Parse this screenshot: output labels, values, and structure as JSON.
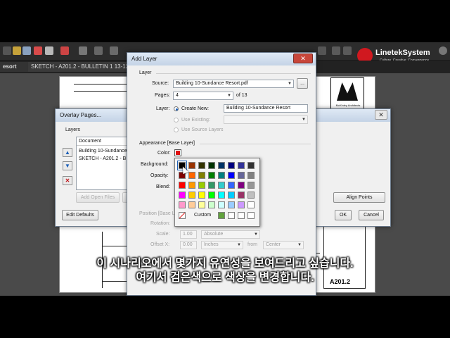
{
  "app": {
    "tabs": [
      {
        "label": "esort"
      },
      {
        "label": "SKETCH - A201.2 - BULLETIN 1 13-12-"
      }
    ],
    "sheet_number": "A201.2",
    "logo_caption": "McKinley Architects"
  },
  "brand": {
    "name": "LinetekSystem",
    "tagline": "Culture, Creative, Convergence"
  },
  "overlay_pages": {
    "title": "Overlay Pages...",
    "layers_label": "Layers",
    "column_header": "Document",
    "rows": [
      "Building 10-Sundance R",
      "SKETCH - A201.2 - B"
    ],
    "add_open_files": "Add Open Files",
    "align_points": "Align Points",
    "edit_defaults": "Edit Defaults",
    "ok": "OK",
    "cancel": "Cancel"
  },
  "add_layer": {
    "title": "Add Layer",
    "layer_section": "Layer",
    "source_label": "Source:",
    "source_value": "Building 10-Sundance Resort.pdf",
    "browse_label": "...",
    "pages_label": "Pages:",
    "pages_value": "4",
    "pages_of": "of 13",
    "layer_label": "Layer:",
    "create_new_label": "Create New:",
    "create_new_value": "Building 10-Sundance Resort",
    "use_existing_label": "Use Existing:",
    "use_source_layers_label": "Use Source Layers",
    "appearance_section": "Appearance [Base Layer]",
    "color_label": "Color:",
    "background_label": "Background:",
    "opacity_label": "Opacity:",
    "blend_label": "Blend:",
    "position_section": "Position [Base La",
    "rotation_label": "Rotation:",
    "scale_label": "Scale:",
    "scale_value": "1.00",
    "scale_mode": "Absolute",
    "offset_label": "Offset X:",
    "offset_value": "0.00",
    "offset_unit": "Inches",
    "from_label": "from",
    "from_value": "Center"
  },
  "color_picker": {
    "custom_label": "Custom",
    "selected_color": "#000000",
    "rows": [
      [
        "#000000",
        "#993300",
        "#333300",
        "#003300",
        "#003366",
        "#000080",
        "#333399",
        "#333333"
      ],
      [
        "#800000",
        "#FF6600",
        "#808000",
        "#008000",
        "#008080",
        "#0000FF",
        "#666699",
        "#808080"
      ],
      [
        "#FF0000",
        "#FF9900",
        "#99CC00",
        "#339966",
        "#33CCCC",
        "#3366FF",
        "#800080",
        "#969696"
      ],
      [
        "#FF00FF",
        "#FFCC00",
        "#FFFF00",
        "#00FF00",
        "#00FFFF",
        "#00CCFF",
        "#993366",
        "#C0C0C0"
      ],
      [
        "#FF99CC",
        "#FFCC99",
        "#FFFF99",
        "#CCFFCC",
        "#CCFFFF",
        "#99CCFF",
        "#CC99FF",
        "#FFFFFF"
      ]
    ],
    "custom_swatches": [
      "#62A33D",
      "#FFFFFF",
      "#FFFFFF",
      "#FFFFFF"
    ]
  },
  "subtitles": {
    "line1": "이 시나리오에서 몇가지 유연성을 보여드리고 싶습니다.",
    "line2": "여기서 검은색으로 색상을 변경합니다."
  },
  "colors": {
    "brand_red": "#d0181f",
    "accent_blue": "#1b5fb8",
    "remove_red": "#c0141a"
  }
}
